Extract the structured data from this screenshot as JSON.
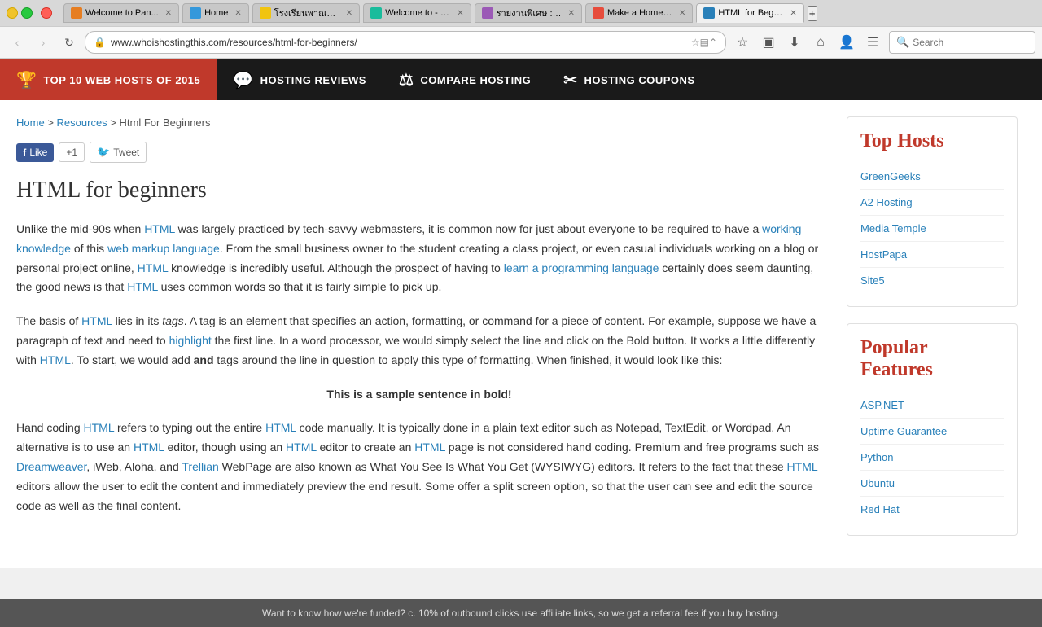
{
  "browser": {
    "tabs": [
      {
        "id": 1,
        "label": "Welcome to Pan...",
        "favicon_class": "tab-fav-1",
        "active": false
      },
      {
        "id": 2,
        "label": "Home",
        "favicon_class": "tab-fav-2",
        "active": false
      },
      {
        "id": 3,
        "label": "โรงเรียนพาณทอง ...",
        "favicon_class": "tab-fav-3",
        "active": false
      },
      {
        "id": 4,
        "label": "Welcome to - Kr...",
        "favicon_class": "tab-fav-4",
        "active": false
      },
      {
        "id": 5,
        "label": "รายงานพิเศษ : เคล็ดลัด...",
        "favicon_class": "tab-fav-5",
        "active": false
      },
      {
        "id": 6,
        "label": "Make a Home w...",
        "favicon_class": "tab-fav-6",
        "active": false
      },
      {
        "id": 7,
        "label": "HTML for Begin...",
        "favicon_class": "tab-fav-active",
        "active": true
      }
    ],
    "url": "www.whoishostingthis.com/resources/html-for-beginners/",
    "search_placeholder": "Search"
  },
  "nav": {
    "items": [
      {
        "id": "top10",
        "icon": "🏆",
        "label": "TOP 10 WEB HOSTS OF 2015",
        "active": true
      },
      {
        "id": "reviews",
        "icon": "💬",
        "label": "HOSTING REVIEWS",
        "active": false
      },
      {
        "id": "compare",
        "icon": "⚖",
        "label": "COMPARE HOSTING",
        "active": false
      },
      {
        "id": "coupons",
        "icon": "✂",
        "label": "HOSTING COUPONS",
        "active": false
      }
    ]
  },
  "breadcrumb": {
    "home": "Home",
    "resources": "Resources",
    "current": "Html For Beginners",
    "separator": ">"
  },
  "social": {
    "facebook": "Like",
    "gplus": "+1",
    "twitter": "Tweet"
  },
  "article": {
    "title": "HTML for beginners",
    "paragraphs": [
      "Unlike the mid-90s when HTML was largely practiced by tech-savvy webmasters, it is common now for just about everyone to be required to have a working knowledge of this web markup language. From the small business owner to the student creating a class project, or even casual individuals working on a blog or personal project online, HTML knowledge is incredibly useful. Although the prospect of having to learn a programming language certainly does seem daunting, the good news is that HTML uses common words so that it is fairly simple to pick up.",
      "The basis of HTML lies in its tags. A tag is an element that specifies an action, formatting, or command for a piece of content. For example, suppose we have a paragraph of text and need to highlight the first line. In a word processor, we would simply select the line and click on the Bold button. It works a little differently with HTML. To start, we would add and tags around the line in question to apply this type of formatting. When finished, it would look like this:",
      "Hand coding HTML refers to typing out the entire HTML code manually. It is typically done in a plain text editor such as Notepad, TextEdit, or Wordpad. An alternative is to use an HTML editor, though using an HTML editor to create an HTML page is not considered hand coding. Premium and free programs such as Dreamweaver, iWeb, Aloha, and Trellian WebPage are also known as What You See Is What You Get (WYSIWYG) editors. It refers to the fact that these HTML editors allow the user to edit the content and immediately preview the end result. Some offer a split screen option, so that the user can see and edit the source code as well as the final content."
    ],
    "sample_bold": "This is a sample sentence in bold!"
  },
  "sidebar": {
    "top_hosts": {
      "title": "Top Hosts",
      "links": [
        "GreenGeeks",
        "A2 Hosting",
        "Media Temple",
        "HostPapa",
        "Site5"
      ]
    },
    "popular_features": {
      "title": "Popular Features",
      "links": [
        "ASP.NET",
        "Uptime Guarantee",
        "Python",
        "Ubuntu",
        "Red Hat"
      ]
    }
  },
  "footer": {
    "text": "Want to know how we're funded? c. 10% of outbound clicks use affiliate links, so we get a referral fee if you buy hosting."
  }
}
